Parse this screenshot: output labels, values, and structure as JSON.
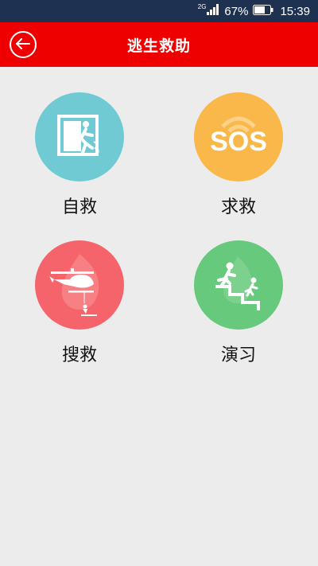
{
  "status_bar": {
    "network": "2G",
    "battery_percent": "67%",
    "time": "15:39"
  },
  "header": {
    "title": "逃生救助",
    "back_icon": "back-arrow-circle-icon"
  },
  "tiles": [
    {
      "label": "自救",
      "icon": "emergency-exit-icon",
      "color": "#6fcad4"
    },
    {
      "label": "求救",
      "icon": "sos-icon",
      "color": "#fbb84a"
    },
    {
      "label": "搜救",
      "icon": "helicopter-rescue-icon",
      "color": "#f5646a"
    },
    {
      "label": "演习",
      "icon": "stair-runners-drill-icon",
      "color": "#66c97c"
    }
  ],
  "colors": {
    "header_bg": "#ee0000",
    "status_bg": "#1f3150",
    "page_bg": "#ececec"
  }
}
